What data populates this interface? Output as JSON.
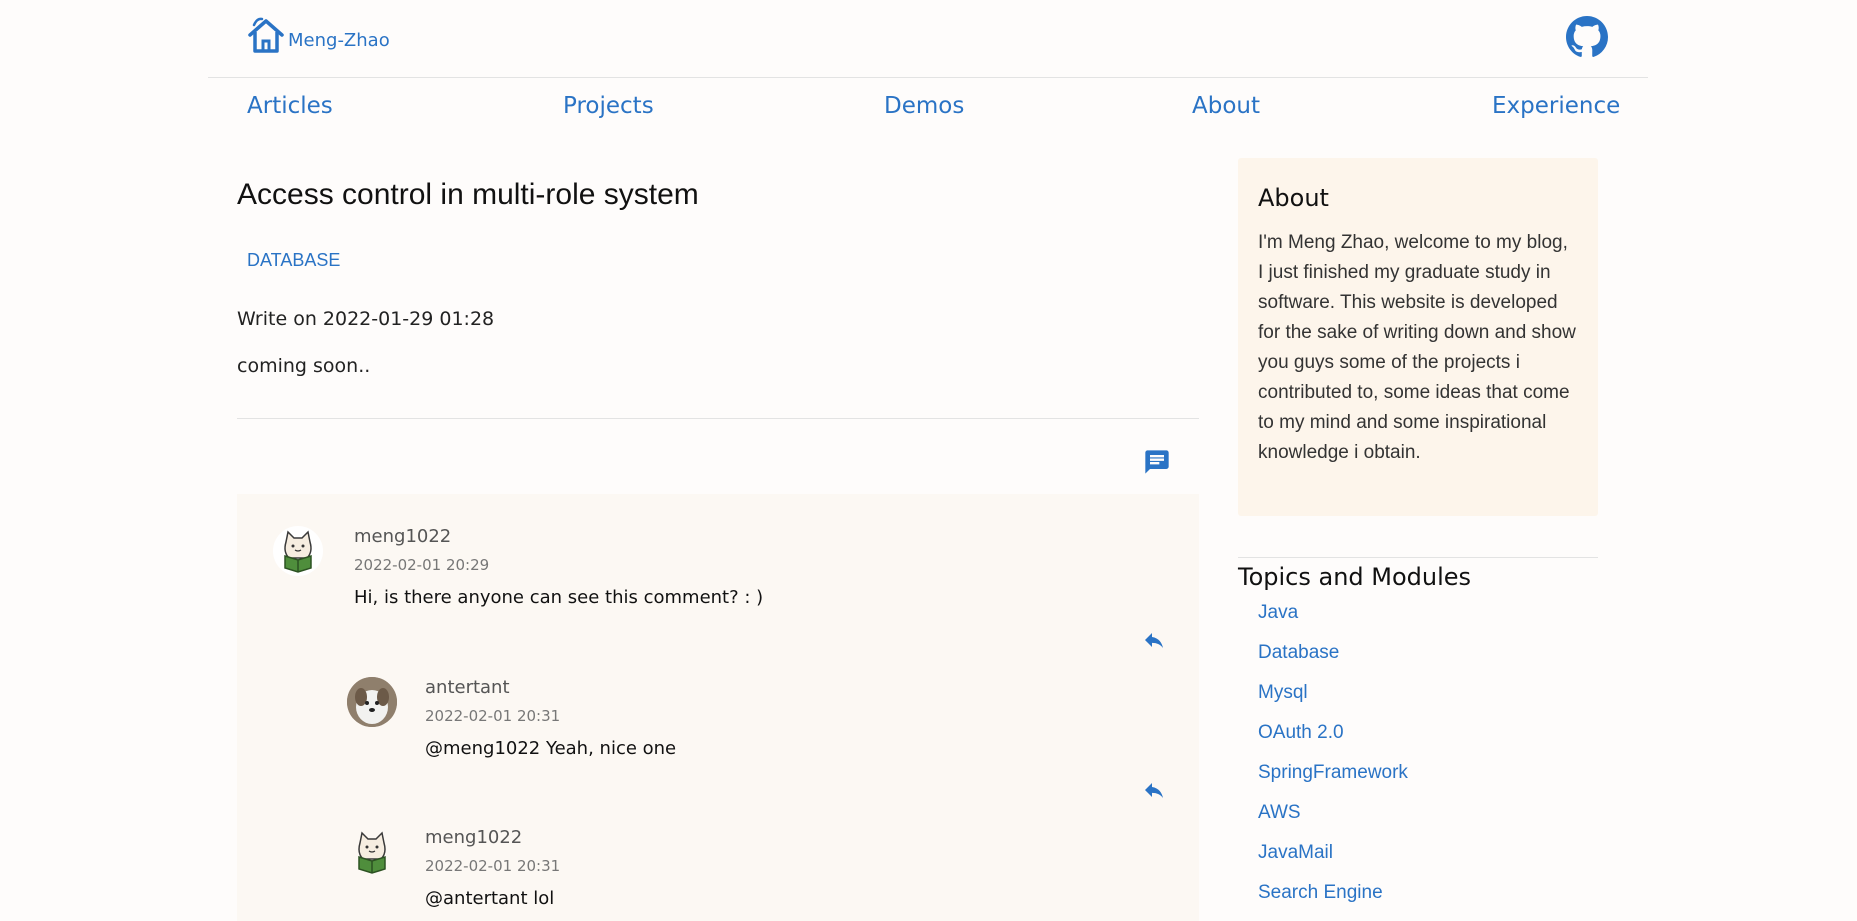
{
  "header": {
    "logo_text": "Meng-Zhao"
  },
  "nav": {
    "items": [
      "Articles",
      "Projects",
      "Demos",
      "About",
      "Experience"
    ]
  },
  "post": {
    "title": "Access control in multi-role system",
    "tag": "DATABASE",
    "date": "Write on 2022-01-29 01:28",
    "content": "coming soon.."
  },
  "comments": [
    {
      "user": "meng1022",
      "date": "2022-02-01 20:29",
      "text": "Hi, is there anyone can see this comment? : )",
      "avatar": "cat-reading-avatar"
    },
    {
      "user": "antertant",
      "date": "2022-02-01 20:31",
      "text": "@meng1022 Yeah, nice one",
      "avatar": "dog-photo-avatar"
    },
    {
      "user": "meng1022",
      "date": "2022-02-01 20:31",
      "text": "@antertant lol",
      "avatar": "cat-reading-avatar"
    }
  ],
  "sidebar": {
    "about_title": "About",
    "about_text": "I'm Meng Zhao, welcome to my blog, I just finished my graduate study in software. This website is developed for the sake of writing down and show you guys some of the projects i contributed to, some ideas that come to my mind and some inspirational knowledge i obtain.",
    "topics_title": "Topics and Modules",
    "topics": [
      "Java",
      "Database",
      "Mysql",
      "OAuth 2.0",
      "SpringFramework",
      "AWS",
      "JavaMail",
      "Search Engine"
    ]
  },
  "colors": {
    "accent": "#2a73c5",
    "panel": "#fdf5eb",
    "comments_bg": "#fcf8f3",
    "background": "#fefcfb"
  }
}
